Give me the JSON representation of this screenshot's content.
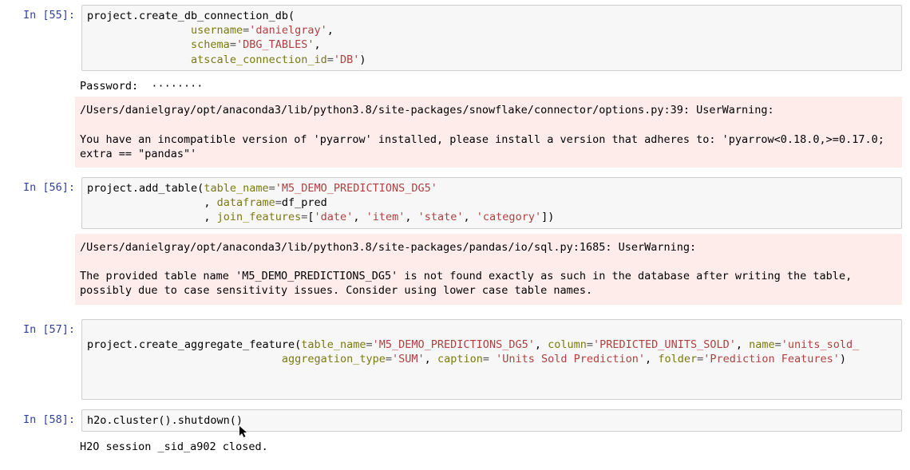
{
  "cells": {
    "c55": {
      "prompt": "In [55]:",
      "code": {
        "l1a": "project.create_db_connection_db(",
        "l2_pad": "                ",
        "l2_kw": "username",
        "l2_eq": "=",
        "l2_val": "'danielgray'",
        "l2_end": ",",
        "l3_pad": "                ",
        "l3_kw": "schema",
        "l3_eq": "=",
        "l3_val": "'DBG_TABLES'",
        "l3_end": ",",
        "l4_pad": "                ",
        "l4_kw": "atscale_connection_id",
        "l4_eq": "=",
        "l4_val": "'DB'",
        "l4_end": ")"
      },
      "out_plain": "Password:  ········",
      "out_warn": "/Users/danielgray/opt/anaconda3/lib/python3.8/site-packages/snowflake/connector/options.py:39: UserWarning:\n\nYou have an incompatible version of 'pyarrow' installed, please install a version that adheres to: 'pyarrow<0.18.0,>=0.17.0; extra == \"pandas\"'"
    },
    "c56": {
      "prompt": "In [56]:",
      "code": {
        "l1a": "project.add_table(",
        "l1_kw1": "table_name",
        "l1_eq": "=",
        "l1_val": "'M5_DEMO_PREDICTIONS_DG5'",
        "l2_pad": "                  , ",
        "l2_kw": "dataframe",
        "l2_eq": "=",
        "l2_val": "df_pred",
        "l3_pad": "                  , ",
        "l3_kw": "join_features",
        "l3_eq": "=",
        "l3_open": "[",
        "l3_v1": "'date'",
        "l3_s1": ", ",
        "l3_v2": "'item'",
        "l3_s2": ", ",
        "l3_v3": "'state'",
        "l3_s3": ", ",
        "l3_v4": "'category'",
        "l3_close": "])"
      },
      "out_warn": "/Users/danielgray/opt/anaconda3/lib/python3.8/site-packages/pandas/io/sql.py:1685: UserWarning:\n\nThe provided table name 'M5_DEMO_PREDICTIONS_DG5' is not found exactly as such in the database after writing the table, possibly due to case sensitivity issues. Consider using lower case table names."
    },
    "c57": {
      "prompt": "In [57]:",
      "code": {
        "l1a": "project.create_aggregate_feature(",
        "kw1": "table_name",
        "eq": "=",
        "v1": "'M5_DEMO_PREDICTIONS_DG5'",
        "s": ", ",
        "kw2": "column",
        "v2": "'PREDICTED_UNITS_SOLD'",
        "kw3": "name",
        "v3": "'units_sold_",
        "l2_pad": "                              ",
        "kw4": "aggregation_type",
        "v4": "'SUM'",
        "kw5": "caption",
        "eq5": "= ",
        "v5": "'Units Sold Prediction'",
        "kw6": "folder",
        "v6": "'Prediction Features'",
        "end": ")"
      }
    },
    "c58": {
      "prompt": "In [58]:",
      "code": {
        "l1": "h2o.cluster().shutdown()"
      },
      "out_plain": "H2O session _sid_a902 closed."
    }
  }
}
